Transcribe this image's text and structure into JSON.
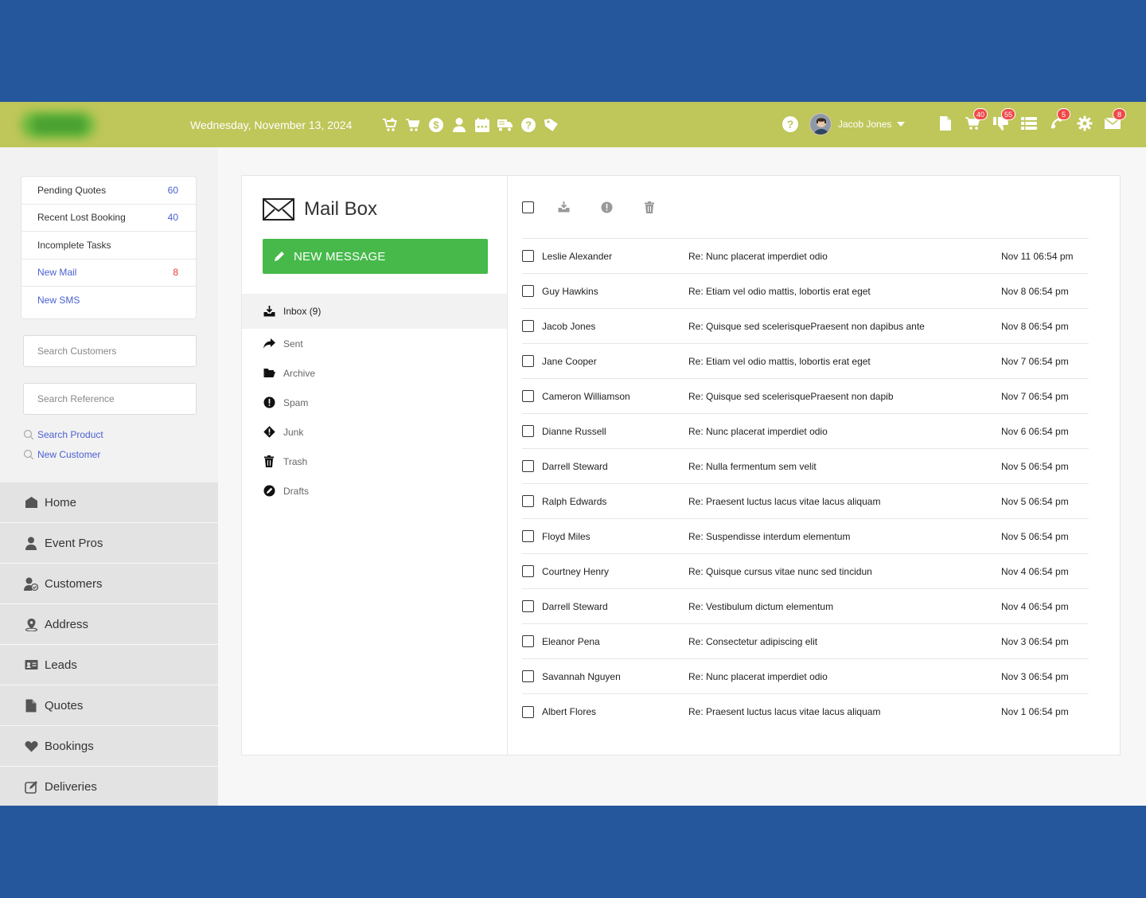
{
  "header": {
    "date": "Wednesday, November 13, 2024",
    "quick_icons": [
      "cart-plus-icon",
      "cart-icon",
      "dollar-icon",
      "user-icon",
      "calendar-icon",
      "delivery-truck-icon",
      "help-icon",
      "tag-icon"
    ],
    "user_name": "Jacob Jones",
    "right_icons": [
      {
        "name": "document-icon",
        "badge": ""
      },
      {
        "name": "cart-icon",
        "badge": "40"
      },
      {
        "name": "thumbs-down-icon",
        "badge": "55"
      },
      {
        "name": "list-icon",
        "badge": ""
      },
      {
        "name": "phone-icon",
        "badge": "5"
      },
      {
        "name": "gear-icon",
        "badge": ""
      },
      {
        "name": "envelope-icon",
        "badge": "8"
      }
    ],
    "colors": {
      "bar": "#bfc65a",
      "outer": "#25579c",
      "badge": "#f04848"
    }
  },
  "sidebar": {
    "stats": [
      {
        "label": "Pending Quotes",
        "value": "60"
      },
      {
        "label": "Recent Lost Booking",
        "value": "40"
      },
      {
        "label": "Incomplete Tasks",
        "value": ""
      },
      {
        "label": "New Mail",
        "value": "8"
      },
      {
        "label": "New SMS",
        "value": ""
      }
    ],
    "search_customers_placeholder": "Search Customers",
    "search_reference_placeholder": "Search Reference",
    "links": [
      "Search Product",
      "New Customer"
    ],
    "nav": [
      "Home",
      "Event Pros",
      "Customers",
      "Address",
      "Leads",
      "Quotes",
      "Bookings",
      "Deliveries"
    ]
  },
  "mailbox": {
    "title": "Mail Box",
    "new_message_label": "NEW MESSAGE",
    "button_color": "#46b94a",
    "folders": [
      "Inbox (9)",
      "Sent",
      "Archive",
      "Spam",
      "Junk",
      "Trash",
      "Drafts"
    ],
    "messages": [
      {
        "from": "Leslie Alexander",
        "subject": "Re: Nunc placerat imperdiet odio",
        "date": "Nov 11 06:54 pm"
      },
      {
        "from": "Guy Hawkins",
        "subject": "Re: Etiam vel odio mattis, lobortis erat eget",
        "date": "Nov 8 06:54 pm"
      },
      {
        "from": "Jacob Jones",
        "subject": "Re: Quisque sed scelerisquePraesent non dapibus ante",
        "date": "Nov 8 06:54 pm"
      },
      {
        "from": "Jane Cooper",
        "subject": "Re: Etiam vel odio mattis, lobortis erat eget",
        "date": "Nov 7 06:54 pm"
      },
      {
        "from": "Cameron Williamson",
        "subject": "Re: Quisque sed scelerisquePraesent non dapib",
        "date": "Nov 7 06:54 pm"
      },
      {
        "from": "Dianne Russell",
        "subject": "Re: Nunc placerat imperdiet odio",
        "date": "Nov 6 06:54 pm"
      },
      {
        "from": "Darrell Steward",
        "subject": "Re: Nulla fermentum sem velit",
        "date": "Nov 5 06:54 pm"
      },
      {
        "from": "Ralph Edwards",
        "subject": "Re: Praesent luctus lacus vitae lacus aliquam",
        "date": "Nov 5 06:54 pm"
      },
      {
        "from": "Floyd Miles",
        "subject": "Re: Suspendisse interdum elementum",
        "date": "Nov 5 06:54 pm"
      },
      {
        "from": "Courtney Henry",
        "subject": "Re: Quisque cursus vitae nunc sed tincidun",
        "date": "Nov 4 06:54 pm"
      },
      {
        "from": "Darrell Steward",
        "subject": "Re: Vestibulum dictum elementum",
        "date": "Nov 4 06:54 pm"
      },
      {
        "from": "Eleanor Pena",
        "subject": "Re: Consectetur adipiscing elit",
        "date": "Nov 3 06:54 pm"
      },
      {
        "from": "Savannah Nguyen",
        "subject": "Re: Nunc placerat imperdiet odio",
        "date": "Nov 3 06:54 pm"
      },
      {
        "from": "Albert Flores",
        "subject": "Re: Praesent luctus lacus vitae lacus aliquam",
        "date": "Nov 1 06:54 pm"
      }
    ]
  }
}
